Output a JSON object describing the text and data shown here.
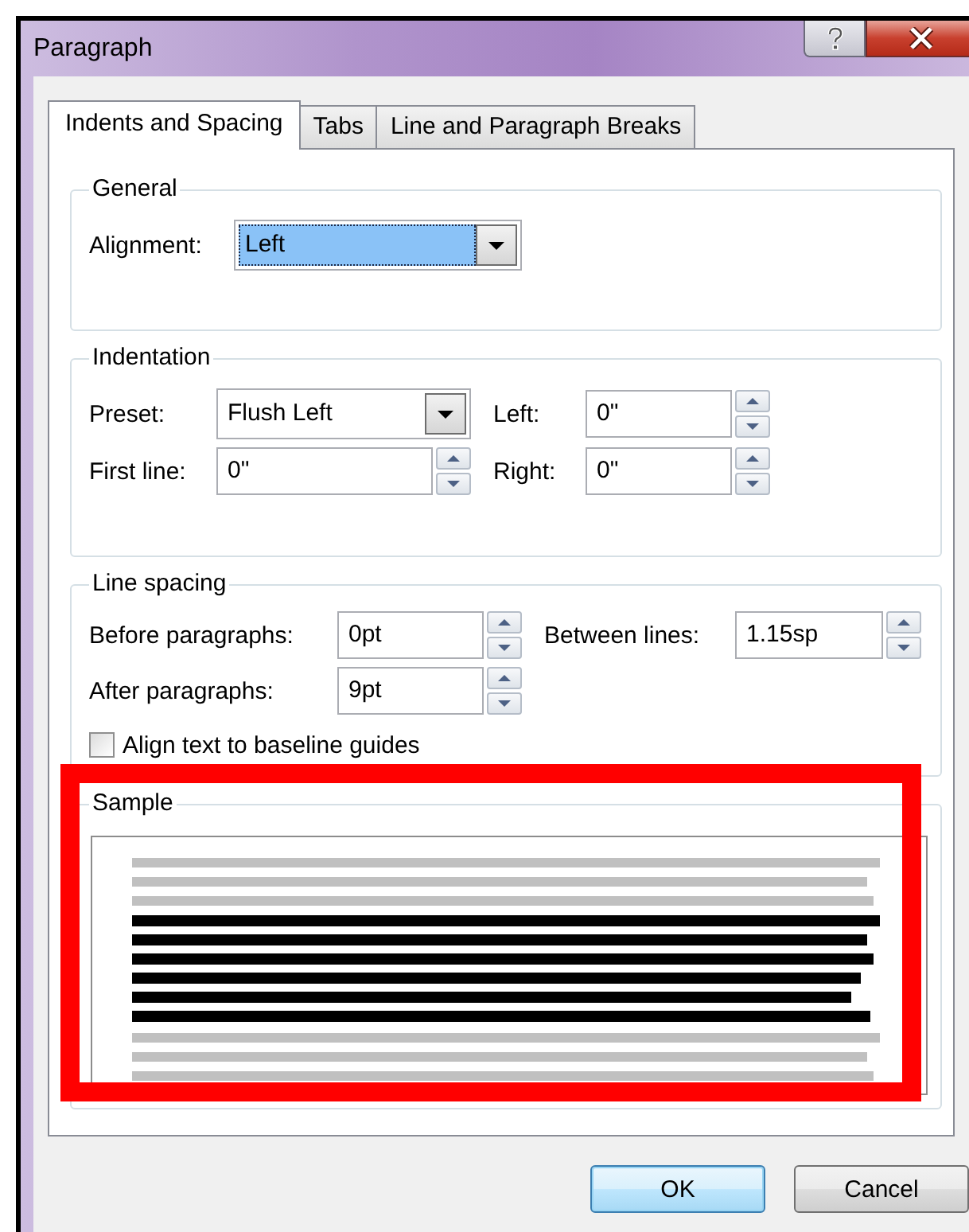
{
  "window": {
    "title": "Paragraph"
  },
  "tabs": [
    {
      "label": "Indents and Spacing",
      "selected": true
    },
    {
      "label": "Tabs",
      "selected": false
    },
    {
      "label": "Line and Paragraph Breaks",
      "selected": false
    }
  ],
  "general": {
    "title": "General",
    "fields": [
      {
        "kind": "dropdown",
        "label": "Alignment:",
        "value": "Left",
        "focused": true
      }
    ]
  },
  "indentation": {
    "title": "Indentation",
    "fields": [
      {
        "kind": "dropdown",
        "label": "Preset:",
        "value": "Flush Left",
        "focused": false
      },
      {
        "kind": "spinner",
        "label": "Left:",
        "value": "0\""
      },
      {
        "kind": "spinner",
        "label": "First line:",
        "value": "0\""
      },
      {
        "kind": "spinner",
        "label": "Right:",
        "value": "0\""
      }
    ]
  },
  "line_spacing": {
    "title": "Line spacing",
    "fields": [
      {
        "kind": "spinner",
        "label": "Before paragraphs:",
        "value": "0pt"
      },
      {
        "kind": "spinner",
        "label": "Between lines:",
        "value": "1.15sp"
      },
      {
        "kind": "spinner",
        "label": "After paragraphs:",
        "value": "9pt"
      }
    ],
    "checkbox": {
      "label": "Align text to baseline guides",
      "checked": false
    }
  },
  "sample": {
    "title": "Sample",
    "highlighted": true
  },
  "buttons": [
    {
      "label": "OK",
      "default": true
    },
    {
      "label": "Cancel",
      "default": false
    }
  ]
}
